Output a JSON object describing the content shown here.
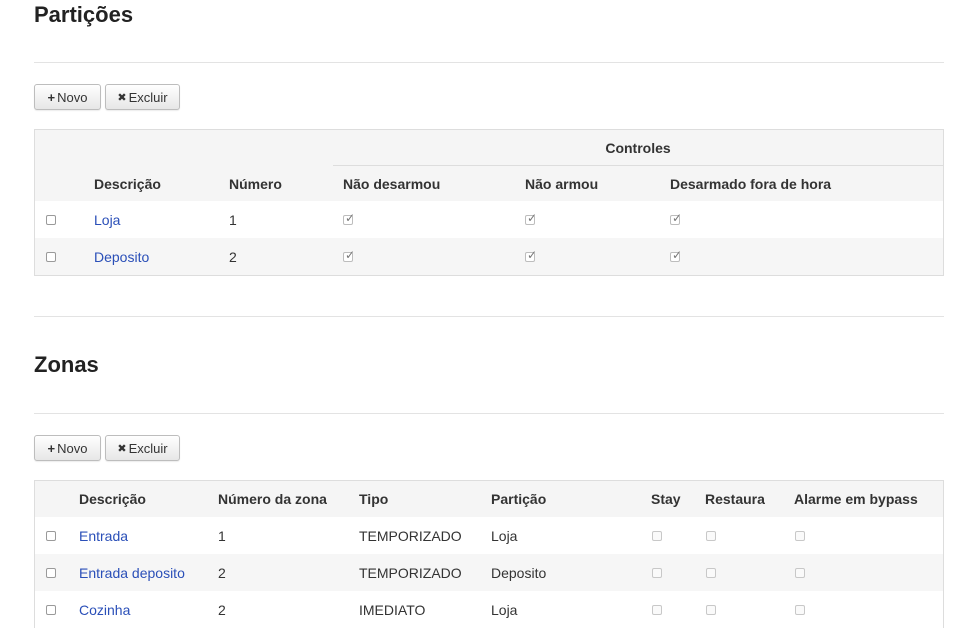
{
  "particoes": {
    "title": "Partições",
    "new_label": "Novo",
    "delete_label": "Excluir",
    "group_header": "Controles",
    "columns": [
      "Descrição",
      "Número",
      "Não desarmou",
      "Não armou",
      "Desarmado fora de hora"
    ],
    "rows": [
      {
        "descricao": "Loja",
        "numero": "1",
        "nao_desarmou": true,
        "nao_armou": true,
        "desarmado_fora_hora": true
      },
      {
        "descricao": "Deposito",
        "numero": "2",
        "nao_desarmou": true,
        "nao_armou": true,
        "desarmado_fora_hora": true
      }
    ]
  },
  "zonas": {
    "title": "Zonas",
    "new_label": "Novo",
    "delete_label": "Excluir",
    "columns": [
      "Descrição",
      "Número da zona",
      "Tipo",
      "Partição",
      "Stay",
      "Restaura",
      "Alarme em bypass"
    ],
    "rows": [
      {
        "descricao": "Entrada",
        "numero": "1",
        "tipo": "TEMPORIZADO",
        "particao": "Loja"
      },
      {
        "descricao": "Entrada deposito",
        "numero": "2",
        "tipo": "TEMPORIZADO",
        "particao": "Deposito"
      },
      {
        "descricao": "Cozinha",
        "numero": "2",
        "tipo": "IMEDIATO",
        "particao": "Loja"
      }
    ]
  },
  "icons": {
    "plus": "+",
    "times": "✖",
    "check": "✓"
  }
}
